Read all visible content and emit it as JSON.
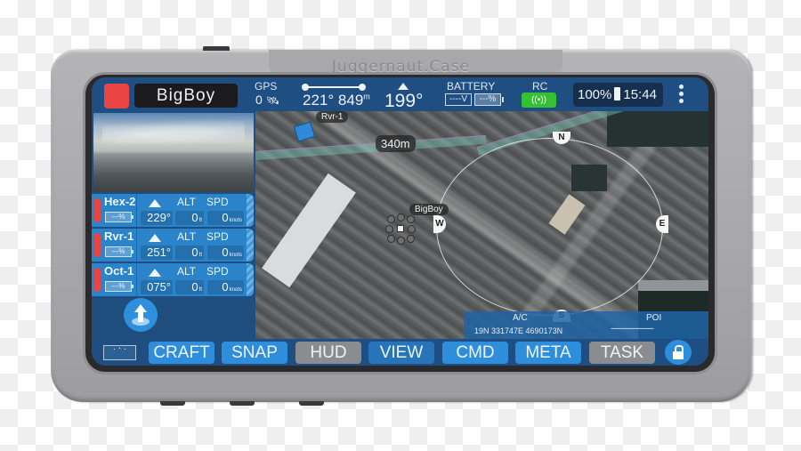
{
  "device": {
    "brand": "Juggernaut.Case"
  },
  "topbar": {
    "vehicle_name": "BigBoy",
    "gps_label": "GPS",
    "gps_sat_count": "0",
    "gps_icon": "satellite-icon",
    "home_bearing": "221°",
    "home_distance": "849",
    "home_distance_unit": "m",
    "heading": "199°",
    "battery_label": "BATTERY",
    "battery_voltage": "----V",
    "battery_percent": "---%",
    "rc_label": "RC",
    "rc_icon": "signal-icon",
    "rc_status_color": "#34c234",
    "device_battery": "100%",
    "clock": "15:44",
    "menu_icon": "kebab-menu-icon",
    "record_color": "#ea4444"
  },
  "map": {
    "labels": {
      "rover": "Rvr-1",
      "vehicle": "BigBoy",
      "range": "340m"
    },
    "compass": {
      "n": "N",
      "s": "S",
      "e": "E",
      "w": "W"
    }
  },
  "crafts": [
    {
      "name": "Hex-2",
      "battery": "---%",
      "heading": "229°",
      "alt_label": "ALT",
      "alt": "0",
      "alt_unit": "ft",
      "spd_label": "SPD",
      "spd": "0",
      "spd_unit": "knots"
    },
    {
      "name": "Rvr-1",
      "battery": "---%",
      "heading": "251°",
      "alt_label": "ALT",
      "alt": "0",
      "alt_unit": "ft",
      "spd_label": "SPD",
      "spd": "0",
      "spd_unit": "knots"
    },
    {
      "name": "Oct-1",
      "battery": "---%",
      "heading": "075°",
      "alt_label": "ALT",
      "alt": "0",
      "alt_unit": "ft",
      "spd_label": "SPD",
      "spd": "0",
      "spd_unit": "knots"
    }
  ],
  "coords": {
    "ac_label": "A/C",
    "ac_value": "19N 331747E 4690173N",
    "poi_label": "POI",
    "poi_value": "------------------------"
  },
  "bottombar": {
    "buttons": [
      {
        "label": "CRAFT",
        "state": "on"
      },
      {
        "label": "SNAP",
        "state": "on"
      },
      {
        "label": "HUD",
        "state": "off"
      },
      {
        "label": "VIEW",
        "state": "dark"
      },
      {
        "label": "CMD",
        "state": "on"
      },
      {
        "label": "META",
        "state": "on"
      },
      {
        "label": "TASK",
        "state": "off"
      }
    ],
    "lock_icon": "lock-icon",
    "fit_icon": "fit-view-icon"
  }
}
